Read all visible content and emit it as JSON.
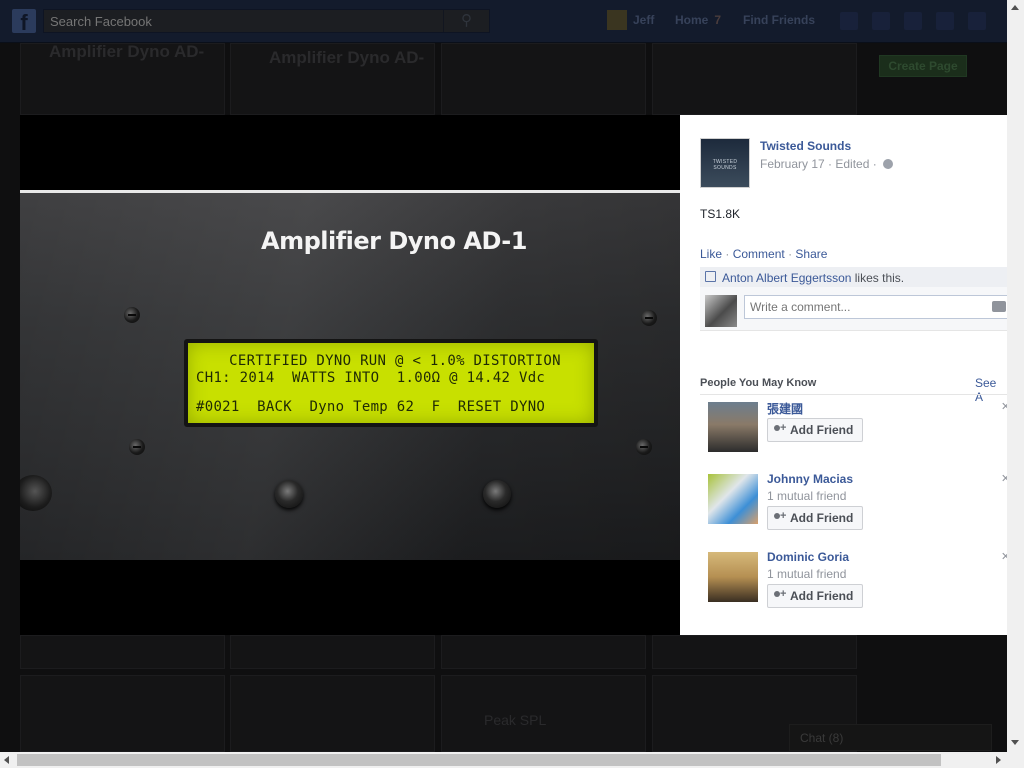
{
  "topbar": {
    "search_placeholder": "Search Facebook",
    "logo": "f",
    "user": "Jeff",
    "home": "Home",
    "home_badge": "7",
    "find_friends": "Find Friends"
  },
  "background": {
    "tile_texts": [
      "Amplifier Dyno AD-",
      "Amplifier Dyno AD-",
      "Peak SPL"
    ],
    "create_page": "Create Page",
    "chat": "Chat (8)"
  },
  "photo": {
    "panel_title": "Amplifier Dyno AD-1",
    "lcd_lines": [
      "CERTIFIED DYNO RUN @ < 1.0% DISTORTION",
      "CH1: 2014  WATTS INTO  1.00Ω @ 14.42 Vdc",
      "#0021  BACK  Dyno Temp 62  F  RESET DYNO"
    ]
  },
  "post": {
    "page_name": "Twisted Sounds",
    "avatar_text": "TWISTED SOUNDS",
    "date": "February 17",
    "edited": "Edited",
    "text": "TS1.8K",
    "actions": {
      "like": "Like",
      "comment": "Comment",
      "share": "Share"
    },
    "liker": "Anton Albert Eggertsson",
    "likes_suffix": "likes this.",
    "comment_placeholder": "Write a comment..."
  },
  "pymk": {
    "title": "People You May Know",
    "see_all": "See A",
    "add_label": "Add Friend",
    "people": [
      {
        "name": "張建國",
        "mutual": ""
      },
      {
        "name": "Johnny Macias",
        "mutual": "1 mutual friend"
      },
      {
        "name": "Dominic Goria",
        "mutual": "1 mutual friend"
      }
    ]
  }
}
